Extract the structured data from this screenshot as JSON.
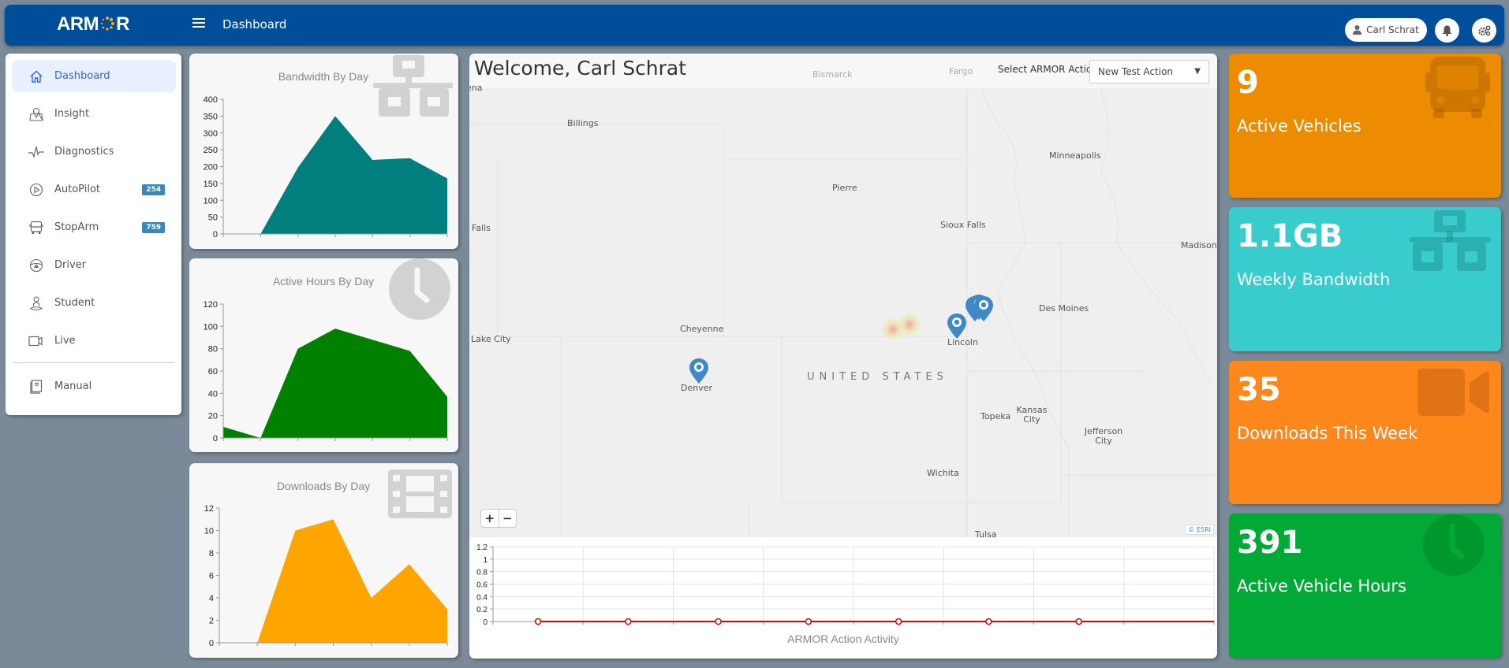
{
  "header": {
    "logo": "ARMOR",
    "title": "Dashboard",
    "user_name": "Carl Schrat"
  },
  "sidebar": {
    "items": [
      {
        "label": "Dashboard",
        "icon": "home-icon",
        "active": true
      },
      {
        "label": "Insight",
        "icon": "map-pin-icon"
      },
      {
        "label": "Diagnostics",
        "icon": "pulse-icon"
      },
      {
        "label": "AutoPilot",
        "icon": "play-circle-icon",
        "badge": "254"
      },
      {
        "label": "StopArm",
        "icon": "bus-icon",
        "badge": "759"
      },
      {
        "label": "Driver",
        "icon": "steering-wheel-icon"
      },
      {
        "label": "Student",
        "icon": "student-icon"
      },
      {
        "label": "Live",
        "icon": "video-camera-icon"
      },
      {
        "label": "Manual",
        "icon": "book-icon"
      }
    ]
  },
  "map": {
    "welcome": "Welcome, Carl Schrat",
    "action_label": "Select ARMOR Action:",
    "action_selected": "New Test Action",
    "country": "UNITED STATES",
    "attribution": "© ESRI",
    "zoom_in": "+",
    "zoom_out": "−",
    "cities": [
      "Bismarck",
      "Fargo",
      "Billings",
      "Minneapolis",
      "Pierre",
      "Sioux Falls",
      "Falls",
      "Madison",
      "Des Moines",
      "Cheyenne",
      "Lake City",
      "Lincoln",
      "Denver",
      "Topeka",
      "Kansas City",
      "Jefferson City",
      "Wichita",
      "Tulsa",
      "ena"
    ]
  },
  "stats": [
    {
      "value": "9",
      "label": "Active Vehicles",
      "color": "#ed8c00",
      "icon": "bus-icon"
    },
    {
      "value": "1.1GB",
      "label": "Weekly Bandwidth",
      "color": "#38cccc",
      "icon": "network-icon"
    },
    {
      "value": "35",
      "label": "Downloads This Week",
      "color": "#fe871b",
      "icon": "video-camera-icon"
    },
    {
      "value": "391",
      "label": "Active Vehicle Hours",
      "color": "#01aa36",
      "icon": "clock-icon"
    }
  ],
  "chart_data": [
    {
      "type": "area",
      "title": "Bandwidth By Day",
      "values": [
        0,
        0,
        197,
        350,
        220,
        225,
        165
      ],
      "ylim": [
        0,
        400
      ],
      "yticks": [
        0,
        50,
        100,
        150,
        200,
        250,
        300,
        350,
        400
      ],
      "color": "#007f7e",
      "xlabel": "",
      "ylabel": ""
    },
    {
      "type": "area",
      "title": "Active Hours By Day",
      "values": [
        10,
        0,
        80,
        98,
        88,
        78,
        37
      ],
      "ylim": [
        0,
        120
      ],
      "yticks": [
        0,
        20,
        40,
        60,
        80,
        100,
        120
      ],
      "color": "#008001",
      "xlabel": "",
      "ylabel": ""
    },
    {
      "type": "area",
      "title": "Downloads By Day",
      "values": [
        0,
        0,
        10,
        11,
        4,
        7,
        3
      ],
      "ylim": [
        0,
        12
      ],
      "yticks": [
        0,
        2,
        4,
        6,
        8,
        10,
        12
      ],
      "color": "#ffa500",
      "xlabel": "",
      "ylabel": ""
    },
    {
      "type": "line",
      "title": "ARMOR Action Activity",
      "values": [
        0,
        0,
        0,
        0,
        0,
        0,
        0
      ],
      "ylim": [
        0,
        1.2
      ],
      "yticks": [
        "0",
        "0.2",
        "0.4",
        "0.6",
        "0.8",
        "1",
        "1.2"
      ],
      "color": "#e00000",
      "grid": true,
      "xlabel": "",
      "ylabel": ""
    }
  ]
}
